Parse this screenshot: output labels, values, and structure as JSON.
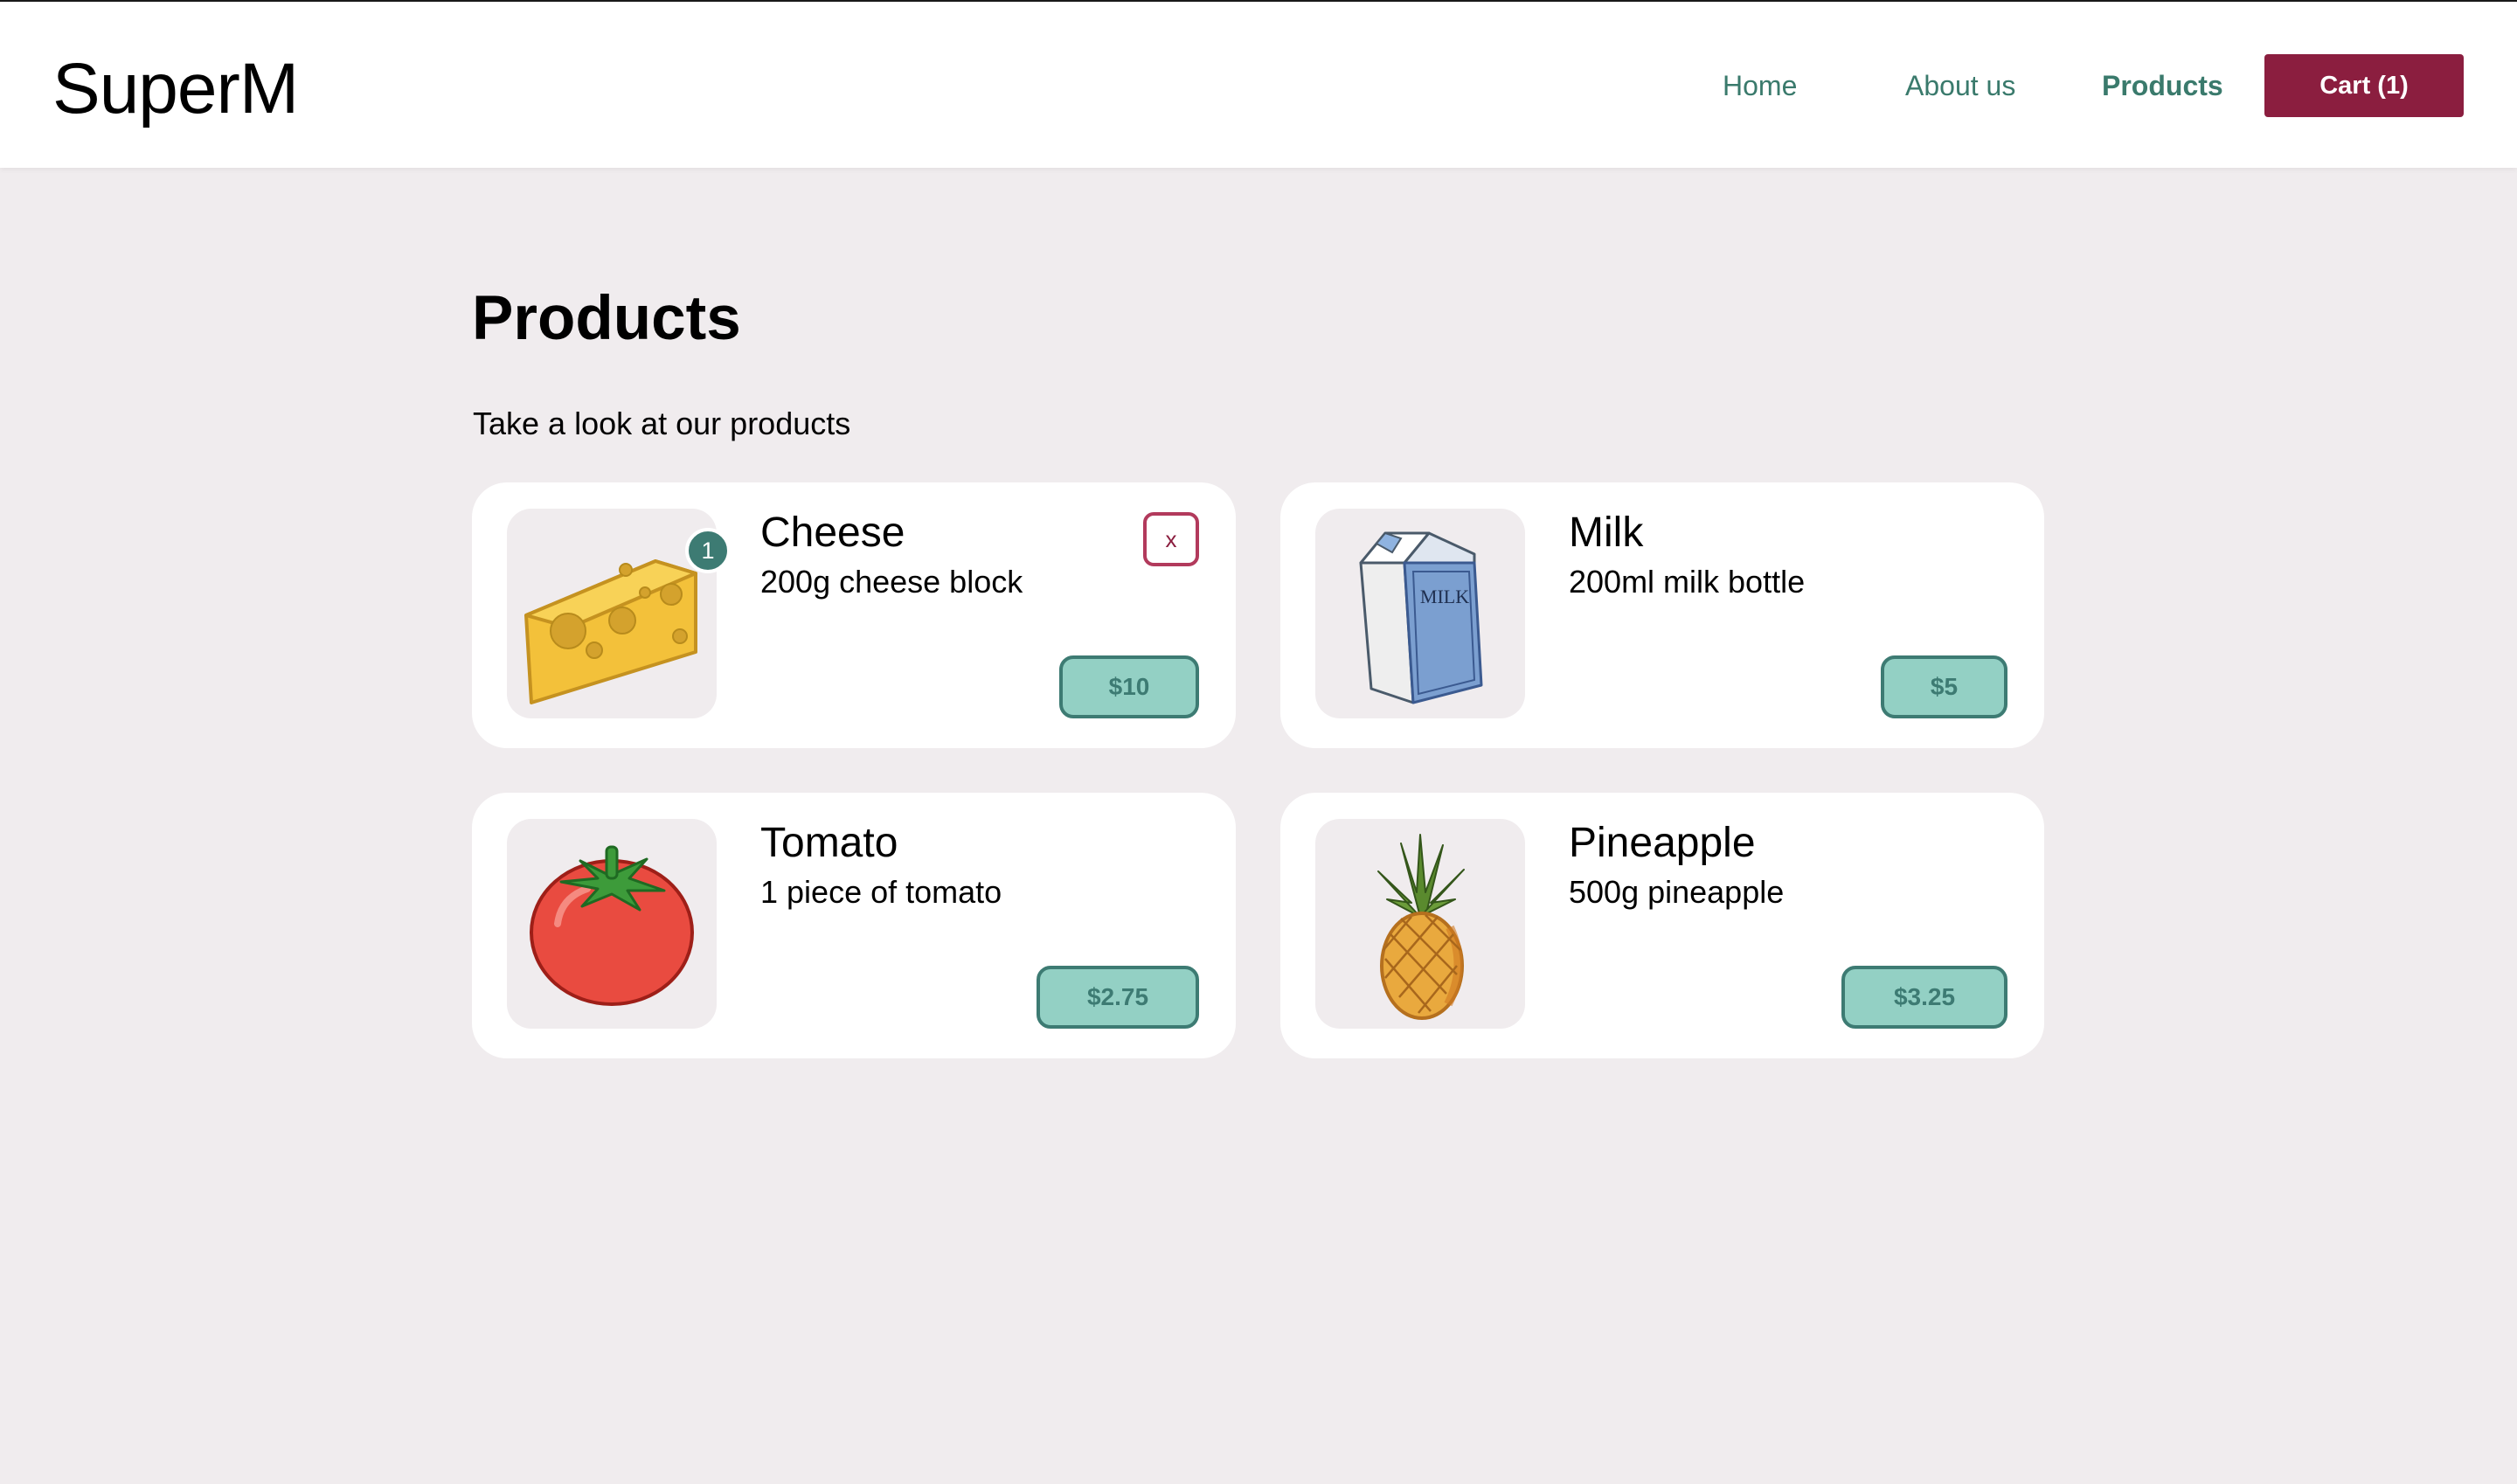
{
  "header": {
    "brand": "SuperM",
    "nav": {
      "home": "Home",
      "about": "About us",
      "products": "Products"
    },
    "cart_label": "Cart (1)"
  },
  "main": {
    "title": "Products",
    "subtitle": "Take a look at our products"
  },
  "products": [
    {
      "name": "Cheese",
      "description": "200g cheese block",
      "price": "$10",
      "quantity": "1",
      "remove_label": "x",
      "icon": "cheese-icon"
    },
    {
      "name": "Milk",
      "description": "200ml milk bottle",
      "price": "$5",
      "icon": "milk-carton-icon",
      "carton_text": "MILK"
    },
    {
      "name": "Tomato",
      "description": "1 piece of tomato",
      "price": "$2.75",
      "icon": "tomato-icon"
    },
    {
      "name": "Pineapple",
      "description": "500g pineapple",
      "price": "$3.25",
      "icon": "pineapple-icon"
    }
  ],
  "colors": {
    "accent_green": "#3d7b73",
    "price_bg": "#93d0c4",
    "cart_bg": "#8b1e3f",
    "page_bg": "#f0ecee"
  }
}
